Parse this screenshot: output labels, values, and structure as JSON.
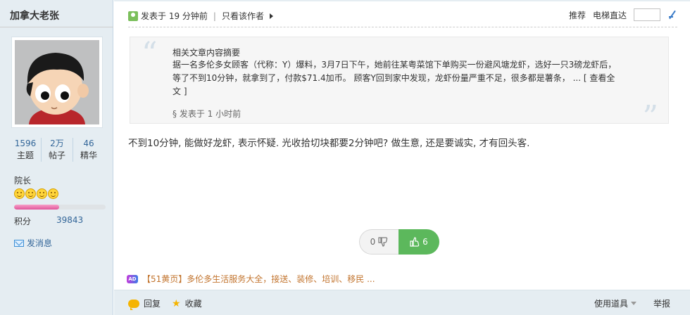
{
  "sidebar": {
    "username": "加拿大老张",
    "stats": [
      {
        "value": "1596",
        "label": "主题"
      },
      {
        "value": "2万",
        "label": "帖子"
      },
      {
        "value": "46",
        "label": "精华"
      }
    ],
    "rank": "院长",
    "rank_progress": 0.49,
    "credits_label": "积分",
    "credits_value": "39843",
    "send_message": "发消息"
  },
  "post": {
    "posted_time": "发表于 19 分钟前",
    "author_only": "只看该作者",
    "recommend": "推荐",
    "elevator": "电梯直达",
    "quote": {
      "title": "相关文章内容摘要",
      "body": "据一名多伦多女顾客（代称：Y）爆料，3月7日下午，她前往某粤菜馆下单购买一份避风塘龙虾，选好一只3磅龙虾后，等了不到10分钟，就拿到了，付款$71.4加币。 顾客Y回到家中发现，龙虾份量严重不足，很多都是薯条， ... ",
      "more_link": "[ 查看全文 ]",
      "posted": "§ 发表于 1 小时前"
    },
    "text": "不到10分钟, 能做好龙虾, 表示怀疑. 光收拾切块都要2分钟吧? 做生意, 还是要诚实, 才有回头客.",
    "votes": {
      "down": "0",
      "up": "6"
    },
    "ad": {
      "badge": "AD",
      "text": "【51黄页】多伦多生活服务大全，接送、装修、培训、移民 ..."
    },
    "footer": {
      "reply": "回复",
      "favorite": "收藏",
      "tools": "使用道具",
      "report": "举报"
    }
  }
}
